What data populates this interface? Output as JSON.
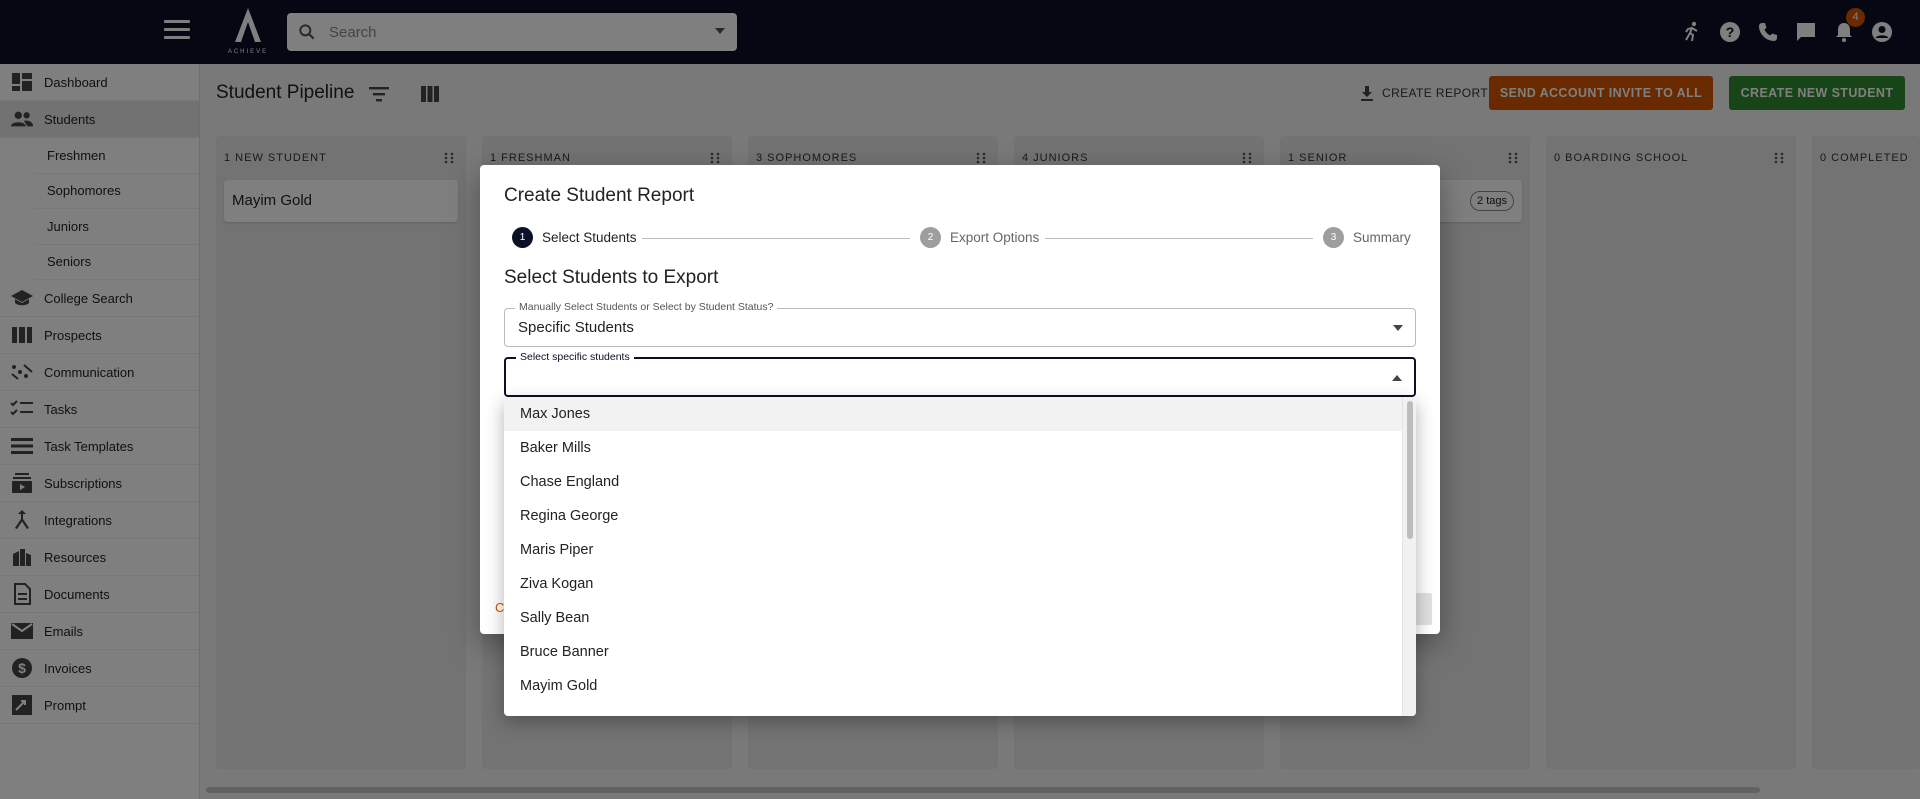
{
  "topbar": {
    "logo_text": "ACHIEVE",
    "search_placeholder": "Search",
    "notification_count": "4",
    "icons": [
      "runner-icon",
      "help-icon",
      "phone-icon",
      "chat-icon",
      "bell-icon",
      "account-icon"
    ]
  },
  "sidebar": {
    "items": [
      {
        "label": "Dashboard",
        "icon": "dashboard-icon"
      },
      {
        "label": "Students",
        "icon": "students-icon",
        "active": true
      },
      {
        "label": "College Search",
        "icon": "graduation-cap-icon"
      },
      {
        "label": "Prospects",
        "icon": "columns-icon"
      },
      {
        "label": "Communication",
        "icon": "communication-icon"
      },
      {
        "label": "Tasks",
        "icon": "checklist-icon"
      },
      {
        "label": "Task Templates",
        "icon": "list-icon"
      },
      {
        "label": "Subscriptions",
        "icon": "subscriptions-icon"
      },
      {
        "label": "Integrations",
        "icon": "merge-icon"
      },
      {
        "label": "Resources",
        "icon": "books-icon"
      },
      {
        "label": "Documents",
        "icon": "document-icon"
      },
      {
        "label": "Emails",
        "icon": "email-icon"
      },
      {
        "label": "Invoices",
        "icon": "dollar-icon"
      },
      {
        "label": "Prompt",
        "icon": "prompt-icon"
      }
    ],
    "subitems": [
      "Freshmen",
      "Sophomores",
      "Juniors",
      "Seniors"
    ]
  },
  "main": {
    "title": "Student Pipeline",
    "create_report_label": "CREATE REPORT",
    "invite_label": "SEND ACCOUNT INVITE TO ALL",
    "create_student_label": "CREATE NEW STUDENT",
    "columns": [
      {
        "header": "1 NEW STUDENT",
        "card": "Mayim Gold"
      },
      {
        "header": "1 FRESHMAN"
      },
      {
        "header": "3 SOPHOMORES"
      },
      {
        "header": "4 JUNIORS"
      },
      {
        "header": "1 SENIOR",
        "tag": "2 tags"
      },
      {
        "header": "0 BOARDING SCHOOL"
      },
      {
        "header": "0 COMPLETED"
      }
    ]
  },
  "dialog": {
    "title": "Create Student Report",
    "steps": [
      {
        "num": "1",
        "label": "Select Students"
      },
      {
        "num": "2",
        "label": "Export Options"
      },
      {
        "num": "3",
        "label": "Summary"
      }
    ],
    "section_title": "Select Students to Export",
    "mode_field": {
      "label": "Manually Select Students or Select by Student Status?",
      "value": "Specific Students"
    },
    "students_field": {
      "label": "Select specific students",
      "value": ""
    },
    "cancel_label": "C"
  },
  "dropdown_options": [
    "Max Jones",
    "Baker Mills",
    "Chase England",
    "Regina George",
    "Maris Piper",
    "Ziva Kogan",
    "Sally Bean",
    "Bruce Banner",
    "Mayim Gold"
  ],
  "colors": {
    "topbar": "#0b1026",
    "accent_orange": "#d35400",
    "accent_green": "#2e8b2e"
  }
}
